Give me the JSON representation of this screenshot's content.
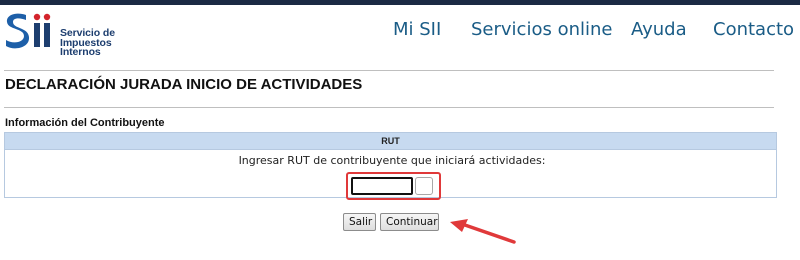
{
  "header": {
    "logo": {
      "mark": "SII",
      "lines": [
        "Servicio de",
        "Impuestos",
        "Internos"
      ]
    },
    "nav": {
      "mi_sii": "Mi SII",
      "servicios": "Servicios online",
      "ayuda": "Ayuda",
      "contacto": "Contacto"
    }
  },
  "page": {
    "title": "DECLARACIÓN JURADA INICIO DE ACTIVIDADES"
  },
  "form": {
    "section_label": "Información del Contribuyente",
    "panel_header": "RUT",
    "instruction": "Ingresar RUT de contribuyente que iniciará actividades:",
    "rut_value": "",
    "dv_value": ""
  },
  "buttons": {
    "salir": "Salir",
    "continuar": "Continuar"
  },
  "colors": {
    "brand": "#1d3e6f",
    "nav_link": "#1a5c86",
    "panel_header_bg": "#c7daf0",
    "highlight": "#e0393a"
  }
}
